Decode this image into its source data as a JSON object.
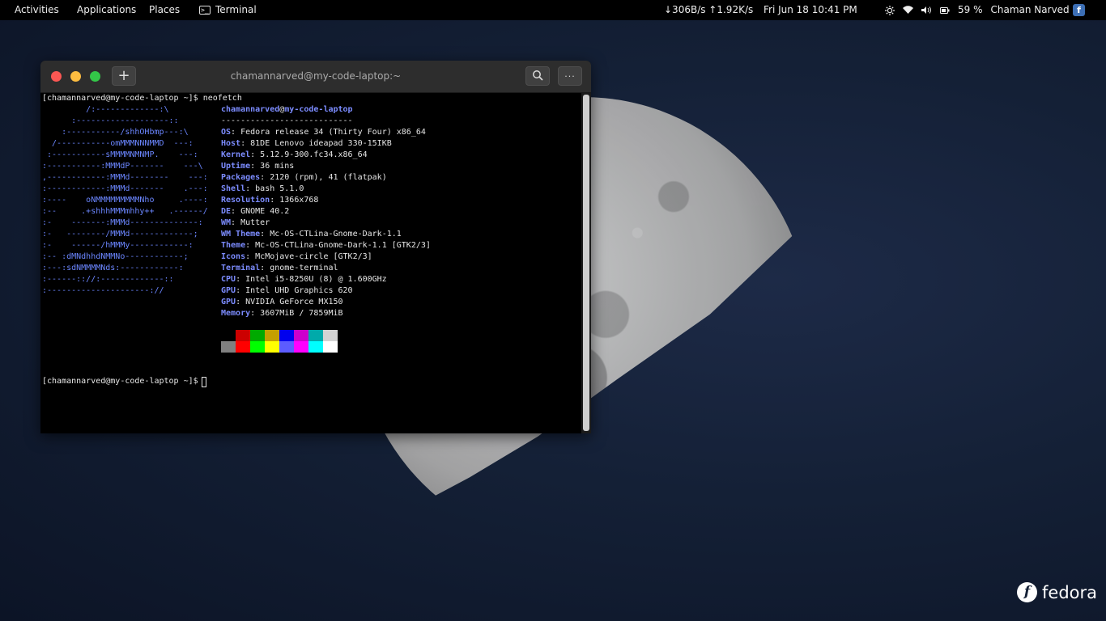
{
  "topbar": {
    "activities": "Activities",
    "applications": "Applications",
    "places": "Places",
    "terminal": "Terminal",
    "terminal_icon": ">_",
    "network": "↓306B/s ↑1.92K/s",
    "clock": "Fri Jun 18  10:41 PM",
    "battery": "59 %",
    "user": "Chaman Narved",
    "fedora_icon": "f",
    "icons": [
      "brightness-icon",
      "wifi-icon",
      "volume-icon",
      "battery-icon"
    ]
  },
  "window": {
    "title": "chamannarved@my-code-laptop:~",
    "new_tab": "+",
    "menu": "···"
  },
  "terminal": {
    "prompt": "[chamannarved@my-code-laptop ~]$ ",
    "command": "neofetch",
    "logo": [
      "         /:-------------:\\",
      "      :-------------------::",
      "    :-----------/shhOHbmp---:\\",
      "  /-----------omMMMNNNMMD  ---:",
      " :-----------sMMMMNMNMP.    ---:",
      ":-----------:MMMdP-------    ---\\",
      ",------------:MMMd--------    ---:",
      ":------------:MMMd-------    .---:",
      ":----    oNMMMMMMMMMNho     .----:",
      ":--     .+shhhMMMmhhy++   .------/",
      ":-    -------:MMMd--------------:",
      ":-   --------/MMMd-------------;",
      ":-    ------/hMMMy------------:",
      ":-- :dMNdhhdNMMNo------------;",
      ":---:sdNMMMMNds:------------:",
      ":------:://:-------------::",
      ":---------------------://"
    ],
    "user": "chamannarved",
    "at": "@",
    "host": "my-code-laptop",
    "separator": "---------------------------",
    "info": [
      {
        "key": "OS",
        "value": "Fedora release 34 (Thirty Four) x86_64"
      },
      {
        "key": "Host",
        "value": "81DE Lenovo ideapad 330-15IKB"
      },
      {
        "key": "Kernel",
        "value": "5.12.9-300.fc34.x86_64"
      },
      {
        "key": "Uptime",
        "value": "36 mins"
      },
      {
        "key": "Packages",
        "value": "2120 (rpm), 41 (flatpak)"
      },
      {
        "key": "Shell",
        "value": "bash 5.1.0"
      },
      {
        "key": "Resolution",
        "value": "1366x768"
      },
      {
        "key": "DE",
        "value": "GNOME 40.2"
      },
      {
        "key": "WM",
        "value": "Mutter"
      },
      {
        "key": "WM Theme",
        "value": "Mc-OS-CTLina-Gnome-Dark-1.1"
      },
      {
        "key": "Theme",
        "value": "Mc-OS-CTLina-Gnome-Dark-1.1 [GTK2/3]"
      },
      {
        "key": "Icons",
        "value": "McMojave-circle [GTK2/3]"
      },
      {
        "key": "Terminal",
        "value": "gnome-terminal"
      },
      {
        "key": "CPU",
        "value": "Intel i5-8250U (8) @ 1.600GHz"
      },
      {
        "key": "GPU",
        "value": "Intel UHD Graphics 620"
      },
      {
        "key": "GPU",
        "value": "NVIDIA GeForce MX150"
      },
      {
        "key": "Memory",
        "value": "3607MiB / 7859MiB"
      }
    ],
    "palette_top": [
      "#000000",
      "#cc0000",
      "#00aa00",
      "#c4a000",
      "#0000ee",
      "#cc00cc",
      "#00aaaa",
      "#d3d3d3"
    ],
    "palette_bottom": [
      "#808080",
      "#ff0000",
      "#00ff00",
      "#ffff00",
      "#5c5cff",
      "#ff00ff",
      "#00ffff",
      "#ffffff"
    ],
    "second_prompt": "[chamannarved@my-code-laptop ~]$ "
  },
  "desktop": {
    "brand": "fedora",
    "brand_icon": "f"
  }
}
